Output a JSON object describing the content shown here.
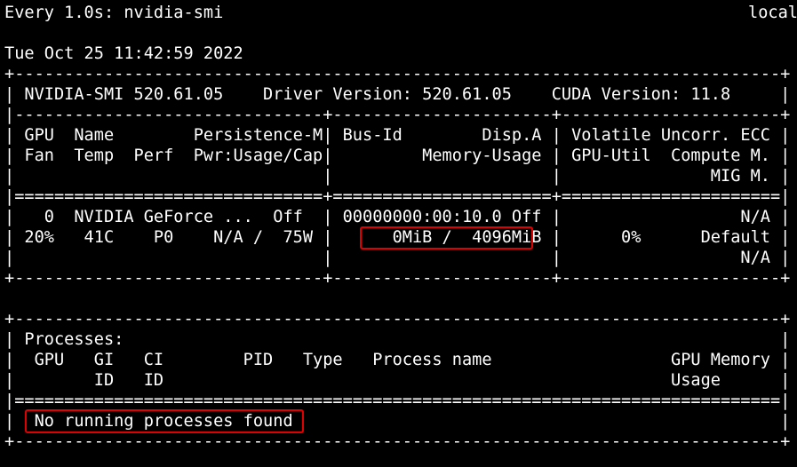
{
  "watch": {
    "title": "Every 1.0s: nvidia-smi",
    "host": "local"
  },
  "timestamp": "Tue Oct 25 11:42:59 2022",
  "smi_lines": [
    "+-----------------------------------------------------------------------------+",
    "| NVIDIA-SMI 520.61.05    Driver Version: 520.61.05    CUDA Version: 11.8     |",
    "|-------------------------------+----------------------+----------------------+",
    "| GPU  Name        Persistence-M| Bus-Id        Disp.A | Volatile Uncorr. ECC |",
    "| Fan  Temp  Perf  Pwr:Usage/Cap|         Memory-Usage | GPU-Util  Compute M. |",
    "|                               |                      |               MIG M. |",
    "|===============================+======================+======================|",
    "|   0  NVIDIA GeForce ...  Off  | 00000000:00:10.0 Off |                  N/A |",
    "| 20%   41C    P0    N/A /  75W |      0MiB /  4096MiB |      0%      Default |",
    "|                               |                      |                  N/A |",
    "+-------------------------------+----------------------+----------------------+",
    "",
    "+-----------------------------------------------------------------------------+",
    "| Processes:                                                                  |",
    "|  GPU   GI   CI        PID   Type   Process name                  GPU Memory |",
    "|        ID   ID                                                   Usage      |",
    "|=============================================================================|",
    "|  No running processes found                                                 |",
    "+-----------------------------------------------------------------------------+"
  ],
  "highlights": {
    "memory_usage": "0MiB /  4096MiB",
    "processes_status": "No running processes found",
    "color": "#e00000"
  }
}
